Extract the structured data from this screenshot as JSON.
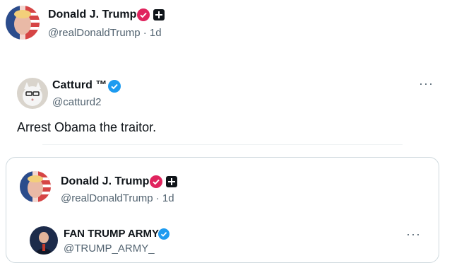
{
  "post": {
    "author_name": "Donald J. Trump",
    "handle": "@realDonaldTrump",
    "sep": "·",
    "time": "1d"
  },
  "quoted": {
    "author_name": "Catturd ™",
    "handle": "@catturd2",
    "text": "Arrest Obama the traitor.",
    "more": "···"
  },
  "nested": {
    "author_name": "Donald J. Trump",
    "handle": "@realDonaldTrump",
    "sep": "·",
    "time": "1d"
  },
  "inner": {
    "author_name": "FAN TRUMP ARMY",
    "handle": "@TRUMP_ARMY_",
    "more": "···"
  },
  "colors": {
    "verified_pink": "#e0245e",
    "verified_blue": "#1d9bf0",
    "text_primary": "#0f1419",
    "text_secondary": "#536471"
  }
}
